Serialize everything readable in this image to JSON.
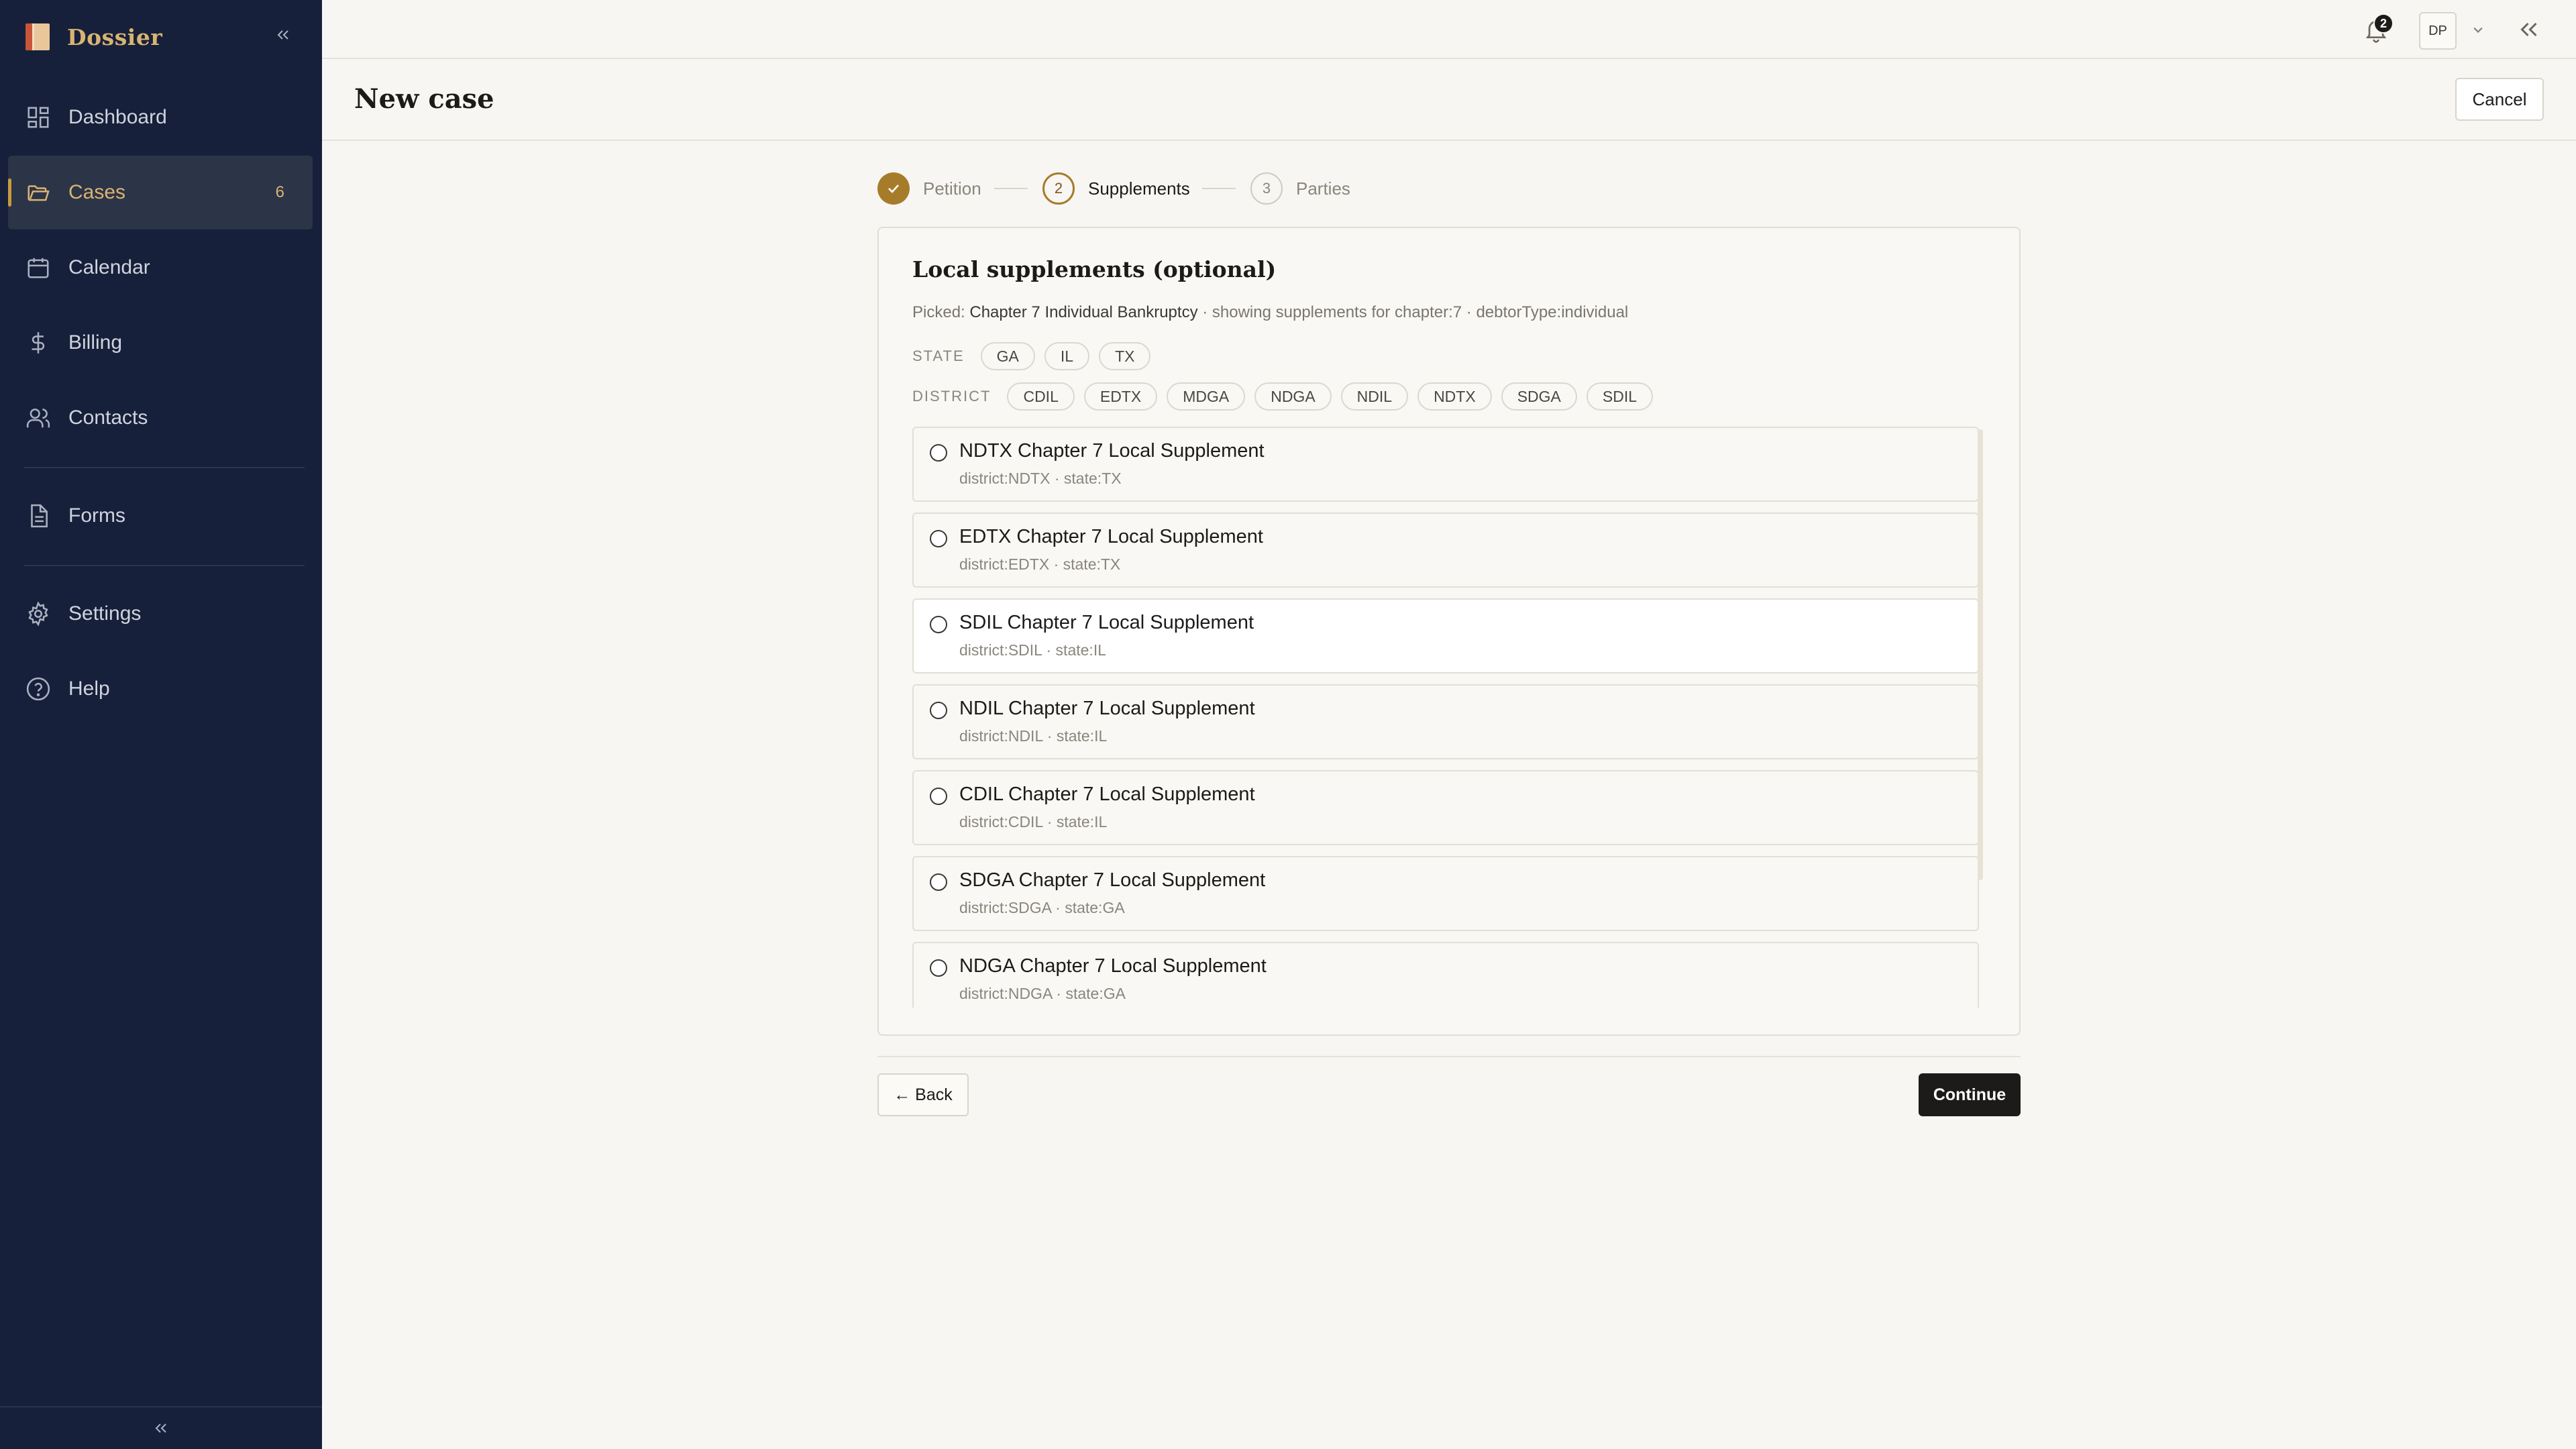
{
  "app": {
    "name": "Dossier"
  },
  "sidebar": {
    "items": [
      {
        "label": "Dashboard",
        "icon": "dashboard-icon"
      },
      {
        "label": "Cases",
        "icon": "folder-icon",
        "badge": "6",
        "active": true
      },
      {
        "label": "Calendar",
        "icon": "calendar-icon"
      },
      {
        "label": "Billing",
        "icon": "dollar-icon"
      },
      {
        "label": "Contacts",
        "icon": "users-icon"
      },
      {
        "label": "Forms",
        "icon": "document-icon"
      },
      {
        "label": "Settings",
        "icon": "gear-icon"
      },
      {
        "label": "Help",
        "icon": "help-icon"
      }
    ]
  },
  "topbar": {
    "notifications": "2",
    "user_initials": "DP"
  },
  "page": {
    "title": "New case",
    "cancel_label": "Cancel"
  },
  "stepper": {
    "steps": [
      {
        "number": "1",
        "label": "Petition",
        "status": "done"
      },
      {
        "number": "2",
        "label": "Supplements",
        "status": "current"
      },
      {
        "number": "3",
        "label": "Parties",
        "status": "todo"
      }
    ]
  },
  "card": {
    "title": "Local supplements (optional)",
    "picked_prefix": "Picked: ",
    "picked_value": "Chapter 7 Individual Bankruptcy",
    "picked_suffix": " · showing supplements for chapter:7 · debtorType:individual",
    "state_label": "STATE",
    "states": [
      "GA",
      "IL",
      "TX"
    ],
    "district_label": "DISTRICT",
    "districts": [
      "CDIL",
      "EDTX",
      "MDGA",
      "NDGA",
      "NDIL",
      "NDTX",
      "SDGA",
      "SDIL"
    ],
    "supplements": [
      {
        "title": "NDTX Chapter 7 Local Supplement",
        "meta": "district:NDTX · state:TX"
      },
      {
        "title": "EDTX Chapter 7 Local Supplement",
        "meta": "district:EDTX · state:TX"
      },
      {
        "title": "SDIL Chapter 7 Local Supplement",
        "meta": "district:SDIL · state:IL"
      },
      {
        "title": "NDIL Chapter 7 Local Supplement",
        "meta": "district:NDIL · state:IL"
      },
      {
        "title": "CDIL Chapter 7 Local Supplement",
        "meta": "district:CDIL · state:IL"
      },
      {
        "title": "SDGA Chapter 7 Local Supplement",
        "meta": "district:SDGA · state:GA"
      },
      {
        "title": "NDGA Chapter 7 Local Supplement",
        "meta": "district:NDGA · state:GA"
      }
    ]
  },
  "footer": {
    "back_label": "← Back",
    "continue_label": "Continue"
  },
  "colors": {
    "sidebar_bg": "#17203a",
    "accent": "#a67c2a",
    "brand": "#d8b473",
    "primary_button": "#1c1b19"
  }
}
